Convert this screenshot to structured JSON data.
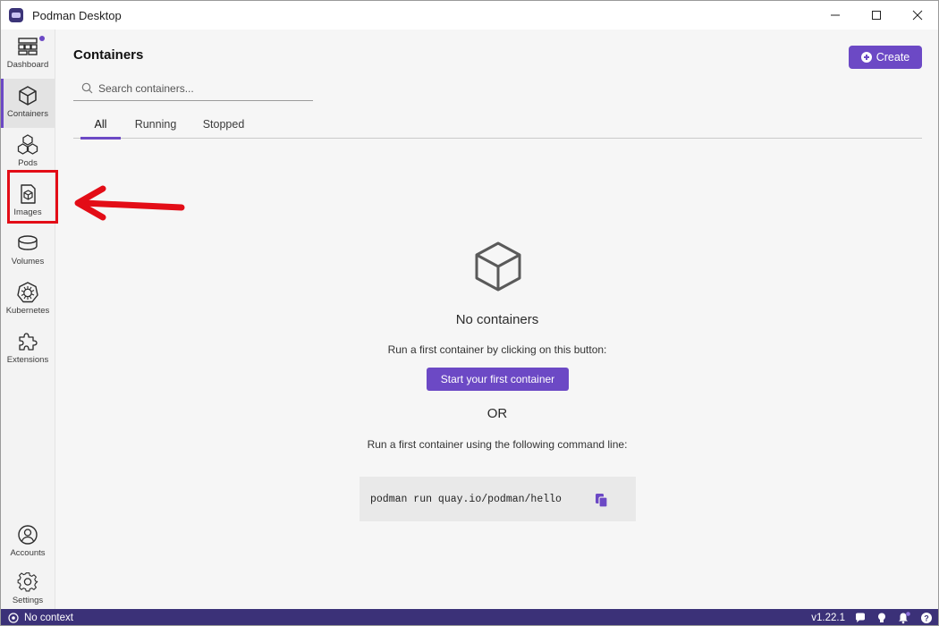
{
  "app": {
    "title": "Podman Desktop"
  },
  "sidebar": {
    "items": [
      {
        "label": "Dashboard",
        "icon": "dashboard-icon",
        "has_notification": true
      },
      {
        "label": "Containers",
        "icon": "container-icon",
        "active": true
      },
      {
        "label": "Pods",
        "icon": "pods-icon"
      },
      {
        "label": "Images",
        "icon": "image-icon"
      },
      {
        "label": "Volumes",
        "icon": "volume-icon"
      },
      {
        "label": "Kubernetes",
        "icon": "kubernetes-icon"
      },
      {
        "label": "Extensions",
        "icon": "puzzle-icon"
      }
    ],
    "bottom_items": [
      {
        "label": "Accounts",
        "icon": "user-icon"
      },
      {
        "label": "Settings",
        "icon": "gear-icon"
      }
    ]
  },
  "main": {
    "title": "Containers",
    "create_label": "Create",
    "search": {
      "placeholder": "Search containers..."
    },
    "tabs": [
      {
        "label": "All",
        "active": true
      },
      {
        "label": "Running"
      },
      {
        "label": "Stopped"
      }
    ],
    "empty": {
      "title": "No containers",
      "description": "Run a first container by clicking on this button:",
      "start_button": "Start your first container",
      "or_text": "OR",
      "command_description": "Run a first container using the following command line:",
      "command": "podman run quay.io/podman/hello"
    }
  },
  "statusbar": {
    "context": "No context",
    "version": "v1.22.1"
  },
  "colors": {
    "accent": "#6c49c5",
    "statusbar": "#3b3178",
    "annotation": "#e30d17"
  }
}
